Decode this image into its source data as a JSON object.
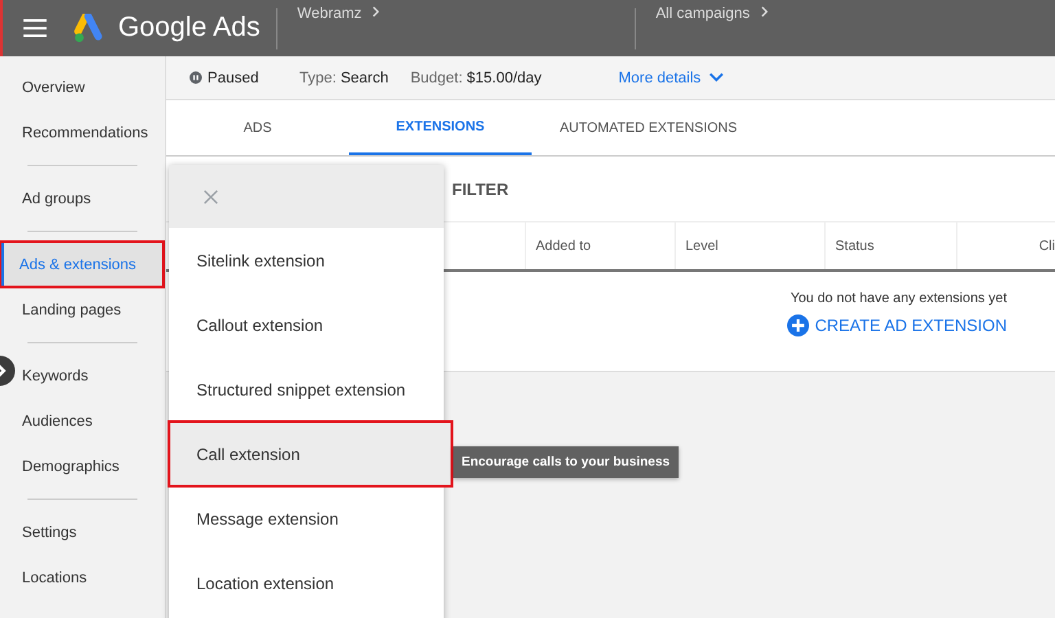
{
  "header": {
    "product": "Google Ads",
    "account": "Webramz",
    "campaign": "All campaigns"
  },
  "sidebar": {
    "groups": [
      [
        {
          "label": "Overview",
          "selected": false,
          "annotated": false
        },
        {
          "label": "Recommendations",
          "selected": false,
          "annotated": false
        }
      ],
      [
        {
          "label": "Ad groups",
          "selected": false,
          "annotated": false
        }
      ],
      [
        {
          "label": "Ads & extensions",
          "selected": true,
          "annotated": true
        },
        {
          "label": "Landing pages",
          "selected": false,
          "annotated": false
        }
      ],
      [
        {
          "label": "Keywords",
          "selected": false,
          "annotated": false
        },
        {
          "label": "Audiences",
          "selected": false,
          "annotated": false
        },
        {
          "label": "Demographics",
          "selected": false,
          "annotated": false
        }
      ],
      [
        {
          "label": "Settings",
          "selected": false,
          "annotated": false
        },
        {
          "label": "Locations",
          "selected": false,
          "annotated": false
        }
      ]
    ]
  },
  "status_bar": {
    "status": "Paused",
    "type_label": "Type:",
    "type_value": "Search",
    "budget_label": "Budget:",
    "budget_value": "$15.00/day",
    "more": "More details"
  },
  "tabs": [
    {
      "label": "ADS",
      "selected": false
    },
    {
      "label": "EXTENSIONS",
      "selected": true
    },
    {
      "label": "AUTOMATED EXTENSIONS",
      "selected": false
    }
  ],
  "filter": "FILTER",
  "table": {
    "columns": [
      "",
      "Added to",
      "Level",
      "Status",
      "Cli"
    ],
    "empty_message": "You do not have any extensions yet",
    "create_button": "CREATE AD EXTENSION"
  },
  "menu": {
    "items": [
      {
        "label": "Sitelink extension",
        "hovered": false,
        "annotated": false
      },
      {
        "label": "Callout extension",
        "hovered": false,
        "annotated": false
      },
      {
        "label": "Structured snippet extension",
        "hovered": false,
        "annotated": false
      },
      {
        "label": "Call extension",
        "hovered": true,
        "annotated": true
      },
      {
        "label": "Message extension",
        "hovered": false,
        "annotated": false
      },
      {
        "label": "Location extension",
        "hovered": false,
        "annotated": false
      }
    ]
  },
  "tooltip": "Encourage calls to your business"
}
